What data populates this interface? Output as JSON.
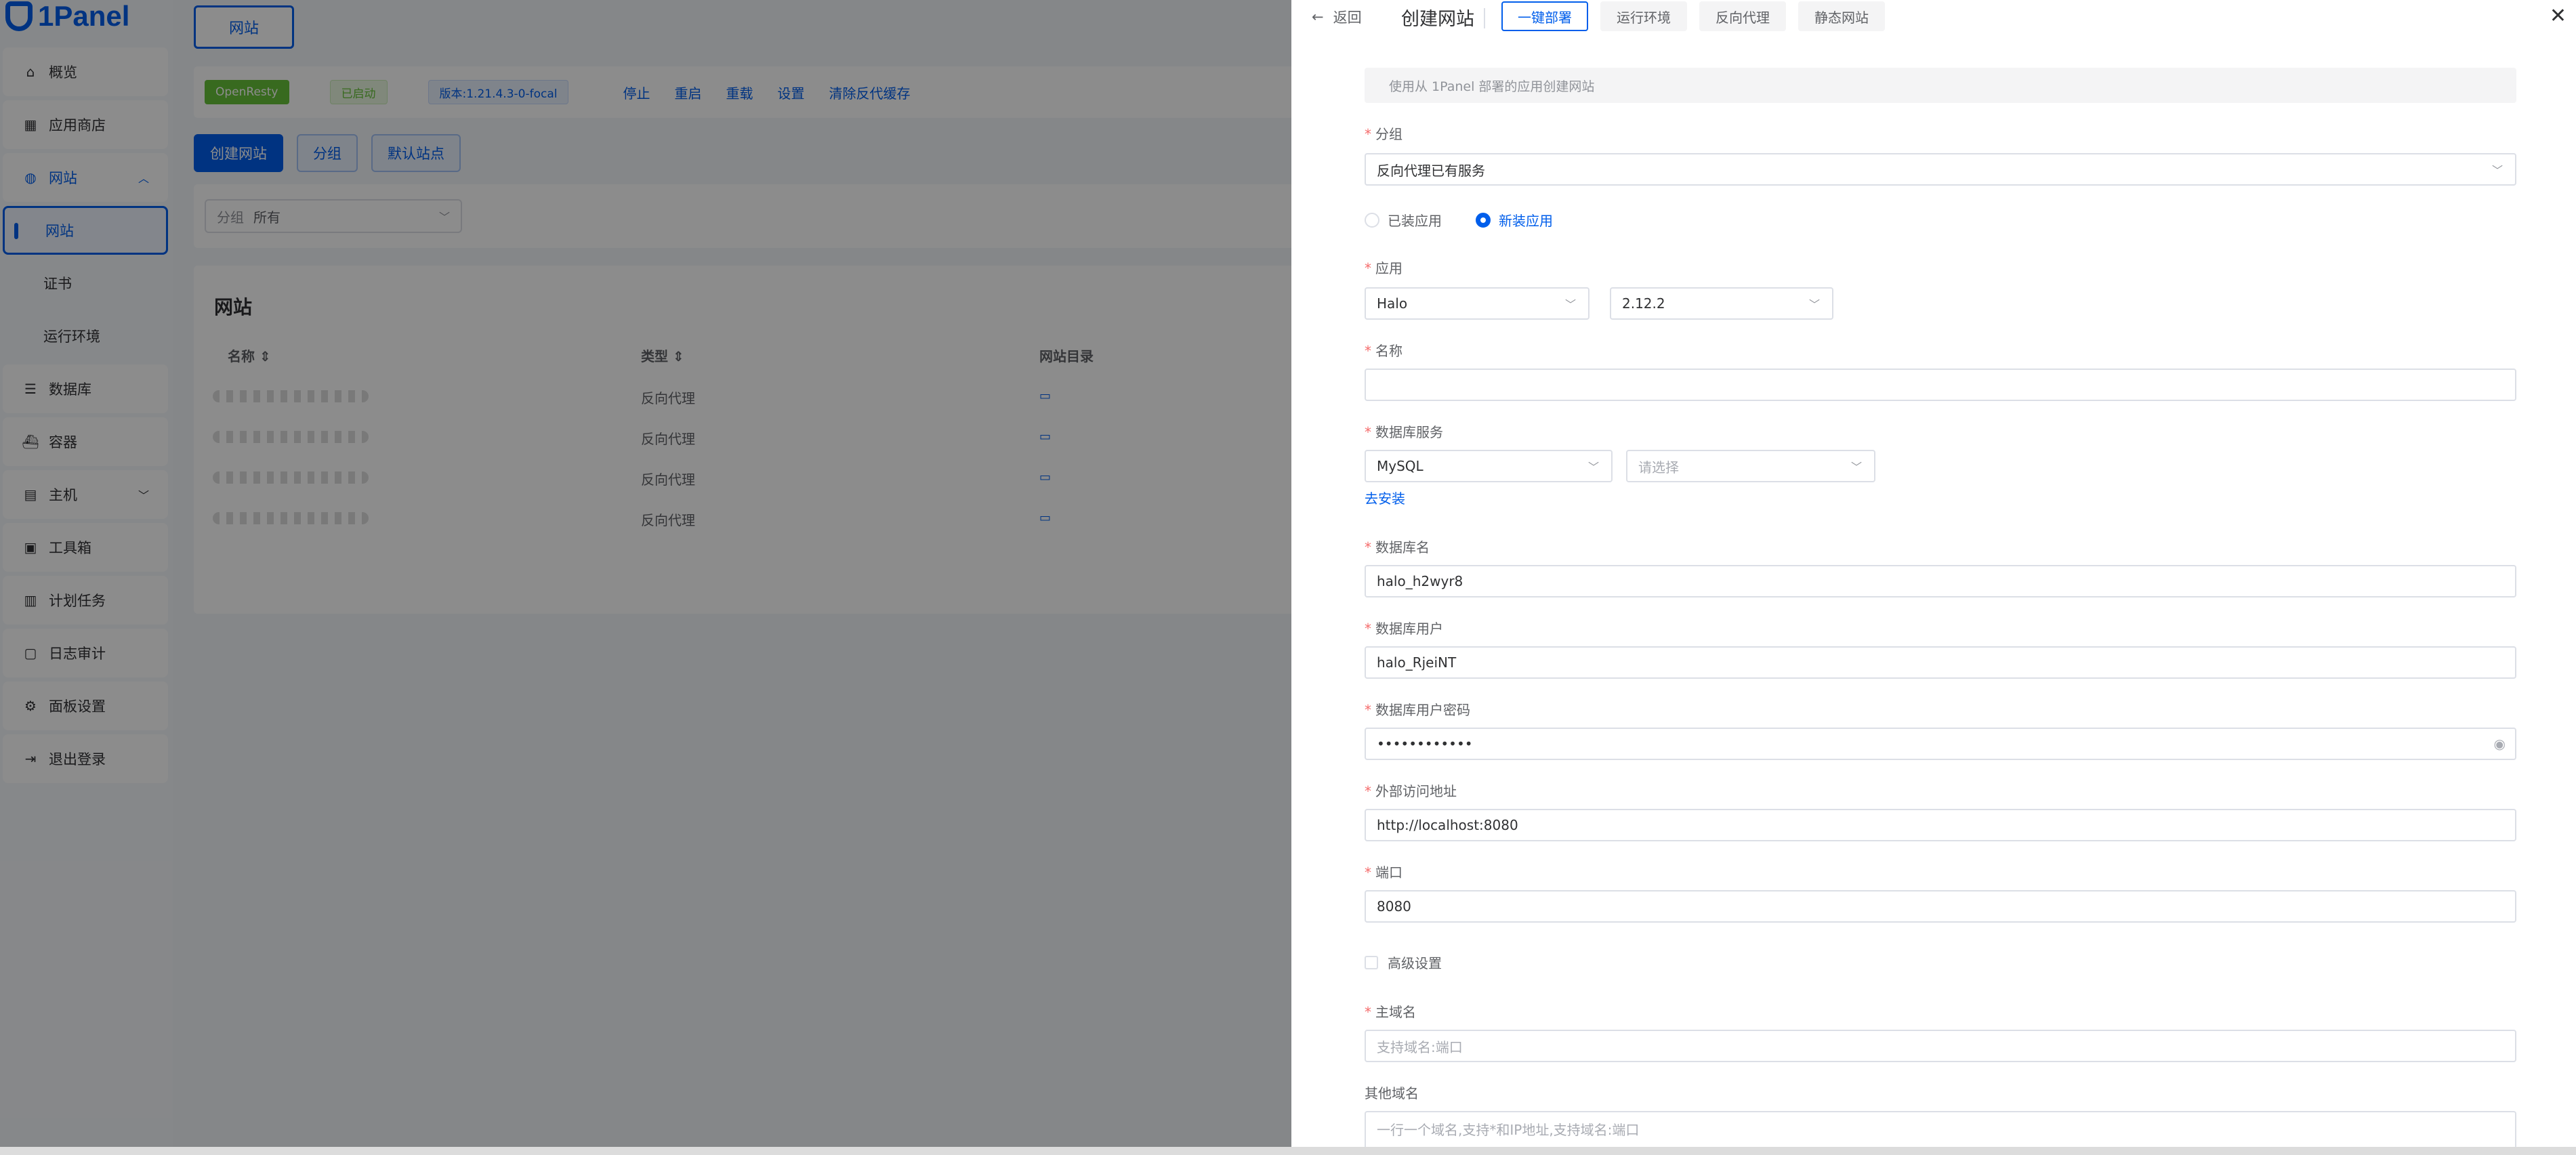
{
  "app": {
    "logo_text": "1Panel"
  },
  "sidebar": {
    "items": [
      {
        "label": "概览",
        "icon": "home-icon"
      },
      {
        "label": "应用商店",
        "icon": "apps-icon"
      },
      {
        "label": "网站",
        "icon": "globe-icon",
        "expanded": true
      },
      {
        "label": "网站",
        "active": true
      },
      {
        "label": "证书"
      },
      {
        "label": "运行环境"
      },
      {
        "label": "数据库",
        "icon": "database-icon"
      },
      {
        "label": "容器",
        "icon": "docker-icon"
      },
      {
        "label": "主机",
        "icon": "server-icon"
      },
      {
        "label": "工具箱",
        "icon": "toolbox-icon"
      },
      {
        "label": "计划任务",
        "icon": "calendar-icon"
      },
      {
        "label": "日志审计",
        "icon": "log-icon"
      },
      {
        "label": "面板设置",
        "icon": "gear-icon"
      },
      {
        "label": "退出登录",
        "icon": "logout-icon"
      }
    ]
  },
  "main": {
    "top_tab": "网站",
    "status": {
      "app_tag": "OpenResty",
      "state_tag": "已启动",
      "version_tag": "版本:1.21.4.3-0-focal",
      "actions": [
        "停止",
        "重启",
        "重载",
        "设置",
        "清除反代缓存"
      ]
    },
    "buttons": {
      "create": "创建网站",
      "group": "分组",
      "default_site": "默认站点"
    },
    "filter": {
      "label": "分组",
      "value": "所有"
    },
    "table": {
      "title": "网站",
      "headers": [
        "名称",
        "类型",
        "网站目录"
      ],
      "rows": [
        {
          "type": "反向代理"
        },
        {
          "type": "反向代理"
        },
        {
          "type": "反向代理"
        },
        {
          "type": "反向代理"
        }
      ]
    }
  },
  "drawer": {
    "back_label": "返回",
    "title": "创建网站",
    "tabs": [
      "一键部署",
      "运行环境",
      "反向代理",
      "静态网站"
    ],
    "active_tab": "一键部署",
    "alert": "使用从 1Panel 部署的应用创建网站",
    "fields": {
      "group": {
        "label": "分组",
        "value": "反向代理已有服务"
      },
      "app_source": {
        "options": [
          "已装应用",
          "新装应用"
        ],
        "selected": "新装应用"
      },
      "app": {
        "label": "应用",
        "value": "Halo",
        "version": "2.12.2"
      },
      "name": {
        "label": "名称",
        "value": ""
      },
      "db_service": {
        "label": "数据库服务",
        "type": "MySQL",
        "instance_placeholder": "请选择",
        "install_link": "去安装"
      },
      "db_name": {
        "label": "数据库名",
        "value": "halo_h2wyr8"
      },
      "db_user": {
        "label": "数据库用户",
        "value": "halo_RjeiNT"
      },
      "db_password": {
        "label": "数据库用户密码",
        "value": "••••••••••••"
      },
      "external_url": {
        "label": "外部访问地址",
        "value": "http://localhost:8080"
      },
      "port": {
        "label": "端口",
        "value": "8080"
      },
      "advanced": {
        "label": "高级设置",
        "checked": false
      },
      "primary_domain": {
        "label": "主域名",
        "placeholder": "支持域名:端口"
      },
      "other_domains": {
        "label": "其他域名",
        "placeholder": "一行一个域名,支持*和IP地址,支持域名:端口"
      }
    }
  },
  "colors": {
    "primary": "#005eeb",
    "required": "#f56c6c",
    "success": "#67c23a"
  }
}
